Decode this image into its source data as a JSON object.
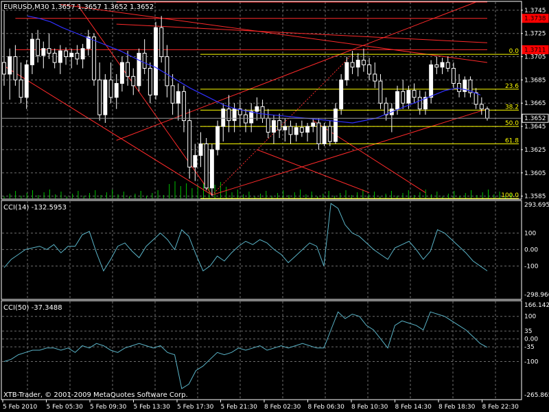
{
  "title": "EURUSD,M30  1.3657 1.3657 1.3652 1.3652",
  "copyright": "XTB-Trader, © 2001-2009 MetaQuotes Software Corp.",
  "colors": {
    "bg": "#000000",
    "frame": "#ffffff",
    "grid": "#6e6e6e",
    "candle": "#ffffff",
    "bull": "#ffffff",
    "bear": "#000000",
    "ma": "#3030ff",
    "trend": "#ff2a2a",
    "fib": "#ffff00",
    "cci": "#5ab4c8",
    "volume": "#00c000",
    "priceBox": "#ffffff",
    "redBox": "#ff0000"
  },
  "price_axis": [
    "1.3745",
    "1.3725",
    "1.3705",
    "1.3685",
    "1.3665",
    "1.3645",
    "1.3625",
    "1.3605",
    "1.3585"
  ],
  "price_tags": [
    {
      "label": "1.3738",
      "value": 1.3738,
      "style": "red"
    },
    {
      "label": "1.3711",
      "value": 1.3711,
      "style": "red"
    },
    {
      "label": "1.3652",
      "value": 1.3652,
      "style": "white"
    }
  ],
  "fib_levels": [
    {
      "label": "0.0",
      "value": 1.3707
    },
    {
      "label": "23.6",
      "value": 1.3677
    },
    {
      "label": "38.2",
      "value": 1.3659
    },
    {
      "label": "50.0",
      "value": 1.3645
    },
    {
      "label": "61.8",
      "value": 1.363
    },
    {
      "label": "100.0",
      "value": 1.3583
    }
  ],
  "cci14": {
    "label": "CCI(14) -132.5953",
    "axis": [
      "293.6955",
      "100",
      "0.00",
      "-100",
      "-298.966"
    ],
    "range": [
      -298.966,
      293.6955
    ]
  },
  "cci50": {
    "label": "CCI(50) -37.3488",
    "axis": [
      "166.1425",
      "100",
      "35",
      "0.00",
      "-35",
      "-100",
      "-265.865"
    ],
    "range": [
      -265.865,
      166.1425
    ]
  },
  "time_axis": [
    "5 Feb 2010",
    "5 Feb 05:30",
    "5 Feb 09:30",
    "5 Feb 13:30",
    "5 Feb 17:30",
    "5 Feb 21:30",
    "8 Feb 02:30",
    "8 Feb 06:30",
    "8 Feb 10:30",
    "8 Feb 14:30",
    "8 Feb 18:30",
    "8 Feb 22:30"
  ],
  "chart_data": {
    "type": "candlestick",
    "symbol": "EURUSD",
    "timeframe": "M30",
    "ylim": [
      1.3583,
      1.3752
    ],
    "candles_ohlc": [
      [
        1.37,
        1.3745,
        1.368,
        1.369
      ],
      [
        1.369,
        1.3712,
        1.3668,
        1.3705
      ],
      [
        1.3705,
        1.3715,
        1.368,
        1.3685
      ],
      [
        1.3685,
        1.37,
        1.3665,
        1.367
      ],
      [
        1.367,
        1.3702,
        1.366,
        1.3698
      ],
      [
        1.3698,
        1.3725,
        1.369,
        1.372
      ],
      [
        1.372,
        1.3728,
        1.37,
        1.3706
      ],
      [
        1.3706,
        1.3718,
        1.3695,
        1.3712
      ],
      [
        1.3712,
        1.3725,
        1.3703,
        1.3708
      ],
      [
        1.3708,
        1.3712,
        1.3695,
        1.37
      ],
      [
        1.37,
        1.3715,
        1.369,
        1.371
      ],
      [
        1.371,
        1.3713,
        1.3698,
        1.3705
      ],
      [
        1.3705,
        1.3712,
        1.3695,
        1.3708
      ],
      [
        1.3708,
        1.3715,
        1.3698,
        1.3703
      ],
      [
        1.3703,
        1.3716,
        1.3695,
        1.3712
      ],
      [
        1.3712,
        1.3728,
        1.3706,
        1.3722
      ],
      [
        1.3722,
        1.3725,
        1.368,
        1.3685
      ],
      [
        1.3685,
        1.37,
        1.365,
        1.3655
      ],
      [
        1.3655,
        1.369,
        1.3648,
        1.3685
      ],
      [
        1.3685,
        1.37,
        1.3665,
        1.367
      ],
      [
        1.367,
        1.369,
        1.366,
        1.3682
      ],
      [
        1.3682,
        1.3705,
        1.3675,
        1.37
      ],
      [
        1.37,
        1.371,
        1.368,
        1.3688
      ],
      [
        1.3688,
        1.3695,
        1.3672,
        1.368
      ],
      [
        1.368,
        1.3712,
        1.3675,
        1.3708
      ],
      [
        1.3708,
        1.372,
        1.369,
        1.3695
      ],
      [
        1.3695,
        1.37,
        1.3665,
        1.3672
      ],
      [
        1.3672,
        1.3735,
        1.3668,
        1.373
      ],
      [
        1.373,
        1.374,
        1.37,
        1.3705
      ],
      [
        1.3705,
        1.3715,
        1.367,
        1.368
      ],
      [
        1.368,
        1.369,
        1.3655,
        1.3665
      ],
      [
        1.3665,
        1.3682,
        1.365,
        1.3675
      ],
      [
        1.3675,
        1.368,
        1.364,
        1.365
      ],
      [
        1.365,
        1.366,
        1.36,
        1.361
      ],
      [
        1.361,
        1.363,
        1.3598,
        1.362
      ],
      [
        1.362,
        1.364,
        1.361,
        1.363
      ],
      [
        1.363,
        1.3635,
        1.359,
        1.3592
      ],
      [
        1.3592,
        1.363,
        1.3585,
        1.3625
      ],
      [
        1.3625,
        1.365,
        1.362,
        1.3645
      ],
      [
        1.3645,
        1.3665,
        1.3632,
        1.366
      ],
      [
        1.366,
        1.3672,
        1.364,
        1.365
      ],
      [
        1.365,
        1.3665,
        1.364,
        1.366
      ],
      [
        1.366,
        1.3668,
        1.3645,
        1.3655
      ],
      [
        1.3655,
        1.366,
        1.364,
        1.3648
      ],
      [
        1.3648,
        1.3665,
        1.364,
        1.3658
      ],
      [
        1.3658,
        1.367,
        1.365,
        1.3662
      ],
      [
        1.3662,
        1.3668,
        1.3648,
        1.3652
      ],
      [
        1.3652,
        1.366,
        1.3635,
        1.364
      ],
      [
        1.364,
        1.3655,
        1.363,
        1.365
      ],
      [
        1.365,
        1.3656,
        1.3635,
        1.3642
      ],
      [
        1.3642,
        1.3652,
        1.3632,
        1.3645
      ],
      [
        1.3645,
        1.365,
        1.363,
        1.3638
      ],
      [
        1.3638,
        1.3648,
        1.3632,
        1.3644
      ],
      [
        1.3644,
        1.365,
        1.3636,
        1.364
      ],
      [
        1.364,
        1.3648,
        1.3632,
        1.3645
      ],
      [
        1.3645,
        1.3652,
        1.364,
        1.3648
      ],
      [
        1.3648,
        1.3652,
        1.3625,
        1.363
      ],
      [
        1.363,
        1.3648,
        1.3628,
        1.3645
      ],
      [
        1.3645,
        1.365,
        1.3628,
        1.3632
      ],
      [
        1.3632,
        1.3665,
        1.363,
        1.366
      ],
      [
        1.366,
        1.369,
        1.3655,
        1.3685
      ],
      [
        1.3685,
        1.3705,
        1.368,
        1.37
      ],
      [
        1.37,
        1.371,
        1.369,
        1.3696
      ],
      [
        1.3696,
        1.3708,
        1.3688,
        1.3702
      ],
      [
        1.3702,
        1.3712,
        1.3692,
        1.3698
      ],
      [
        1.3698,
        1.3704,
        1.3685,
        1.369
      ],
      [
        1.369,
        1.37,
        1.3678,
        1.3684
      ],
      [
        1.3684,
        1.369,
        1.366,
        1.3665
      ],
      [
        1.3665,
        1.367,
        1.365,
        1.3655
      ],
      [
        1.3655,
        1.3665,
        1.364,
        1.366
      ],
      [
        1.366,
        1.368,
        1.3655,
        1.3675
      ],
      [
        1.3675,
        1.3685,
        1.366,
        1.3665
      ],
      [
        1.3665,
        1.368,
        1.366,
        1.3676
      ],
      [
        1.3676,
        1.3682,
        1.3665,
        1.367
      ],
      [
        1.367,
        1.3676,
        1.3655,
        1.366
      ],
      [
        1.366,
        1.3675,
        1.3655,
        1.367
      ],
      [
        1.367,
        1.3702,
        1.3665,
        1.3698
      ],
      [
        1.3698,
        1.3705,
        1.369,
        1.3696
      ],
      [
        1.3696,
        1.3704,
        1.369,
        1.37
      ],
      [
        1.37,
        1.3705,
        1.3692,
        1.3695
      ],
      [
        1.3695,
        1.37,
        1.3678,
        1.3682
      ],
      [
        1.3682,
        1.369,
        1.367,
        1.3675
      ],
      [
        1.3675,
        1.3688,
        1.367,
        1.3685
      ],
      [
        1.3685,
        1.3688,
        1.367,
        1.3674
      ],
      [
        1.3674,
        1.3678,
        1.366,
        1.3664
      ],
      [
        1.3664,
        1.367,
        1.3655,
        1.366
      ],
      [
        1.366,
        1.3662,
        1.365,
        1.3652
      ]
    ],
    "ma_values": [
      1.374,
      1.3738,
      1.3735,
      1.373,
      1.3726,
      1.3722,
      1.3718,
      1.3714,
      1.371,
      1.3705,
      1.37,
      1.3696,
      1.369,
      1.3684,
      1.3678,
      1.3673,
      1.3668,
      1.3663,
      1.366,
      1.3658,
      1.3656,
      1.3655,
      1.3654,
      1.3653,
      1.3652,
      1.3651,
      1.365,
      1.3649,
      1.3648,
      1.365,
      1.3652,
      1.3656,
      1.366,
      1.3664,
      1.3668,
      1.3672,
      1.3676,
      1.3678,
      1.3676,
      1.3672
    ],
    "cci14_values": [
      -110,
      -60,
      -30,
      0,
      10,
      20,
      0,
      30,
      -20,
      20,
      20,
      90,
      110,
      -20,
      -130,
      -60,
      20,
      40,
      -10,
      -50,
      20,
      60,
      100,
      60,
      0,
      120,
      80,
      -30,
      -130,
      -100,
      -40,
      -70,
      -20,
      20,
      50,
      30,
      60,
      40,
      0,
      -30,
      -80,
      -40,
      0,
      40,
      20,
      -100,
      280,
      250,
      150,
      100,
      80,
      40,
      0,
      -30,
      -60,
      10,
      30,
      50,
      0,
      -60,
      -10,
      120,
      100,
      60,
      20,
      -20,
      -70,
      -100,
      -130
    ],
    "cci50_values": [
      -100,
      -90,
      -70,
      -60,
      -50,
      -50,
      -40,
      -40,
      -50,
      -40,
      -60,
      -30,
      -40,
      -20,
      -30,
      -50,
      -60,
      -40,
      -30,
      -20,
      -30,
      -40,
      -30,
      -60,
      -70,
      -220,
      -200,
      -140,
      -120,
      -90,
      -60,
      -70,
      -60,
      -40,
      -50,
      -40,
      -30,
      -50,
      -40,
      -30,
      -40,
      -30,
      -20,
      -30,
      -40,
      -40,
      40,
      120,
      90,
      110,
      100,
      60,
      40,
      0,
      -40,
      60,
      80,
      70,
      60,
      40,
      120,
      110,
      100,
      80,
      60,
      40,
      10,
      -20,
      -37
    ]
  }
}
